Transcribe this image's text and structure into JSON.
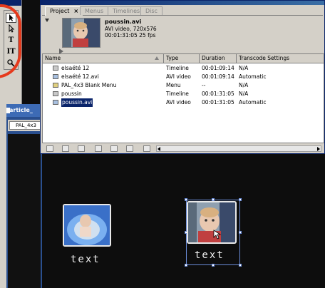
{
  "project": {
    "tabs": [
      "Project",
      "Menus",
      "Timelines",
      "Disc"
    ],
    "tab_close": "×",
    "clip": {
      "name": "poussin.avi",
      "line1": "AVI video, 720x576",
      "line2": "00:01:31:05 25 fps"
    },
    "columns": [
      "Name",
      "Type",
      "Duration",
      "Transcode Settings"
    ],
    "rows": [
      {
        "name": "elsaété 12",
        "type": "Timeline",
        "duration": "00:01:09:14",
        "transcode": "N/A",
        "icon": "timeline-icon"
      },
      {
        "name": "elsaété 12.avi",
        "type": "AVI video",
        "duration": "00:01:09:14",
        "transcode": "Automatic",
        "icon": "video-file-icon"
      },
      {
        "name": "PAL_4x3 Blank Menu",
        "type": "Menu",
        "duration": "--",
        "transcode": "N/A",
        "icon": "menu-icon"
      },
      {
        "name": "poussin",
        "type": "Timeline",
        "duration": "00:01:31:05",
        "transcode": "N/A",
        "icon": "timeline-icon"
      },
      {
        "name": "poussin.avi",
        "type": "AVI video",
        "duration": "00:01:31:05",
        "transcode": "Automatic",
        "icon": "video-file-icon",
        "selected": true
      }
    ]
  },
  "background_window": {
    "title": "article_",
    "subtab": "PAL_4x3"
  },
  "menu_buttons": [
    {
      "label": "text"
    },
    {
      "label": "text"
    }
  ],
  "colors": {
    "selection": "#0a246a",
    "accent": "#e63a1c",
    "handle": "#6a8cd8"
  }
}
